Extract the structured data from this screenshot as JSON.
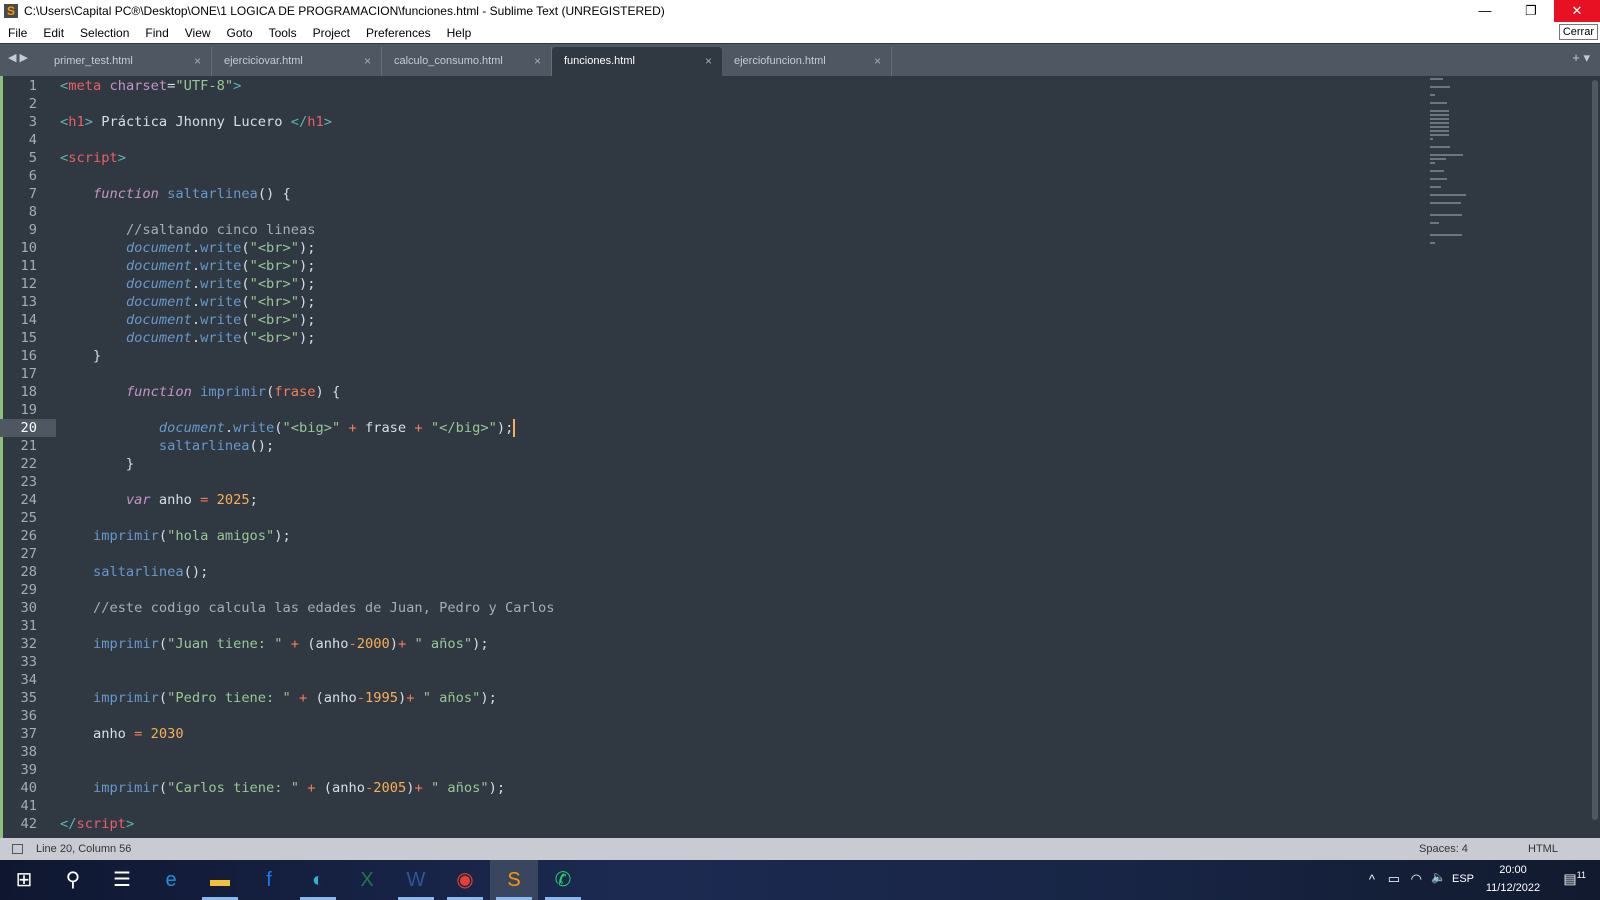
{
  "window": {
    "title": "C:\\Users\\Capital PC®\\Desktop\\ONE\\1 LOGICA DE PROGRAMACION\\funciones.html - Sublime Text (UNREGISTERED)",
    "minimize": "—",
    "restore": "❐",
    "close": "✕",
    "close_tooltip": "Cerrar"
  },
  "menu": [
    "File",
    "Edit",
    "Selection",
    "Find",
    "View",
    "Goto",
    "Tools",
    "Project",
    "Preferences",
    "Help"
  ],
  "tabs": [
    {
      "label": "primer_test.html"
    },
    {
      "label": "ejerciciovar.html"
    },
    {
      "label": "calculo_consumo.html"
    },
    {
      "label": "funciones.html",
      "active": true
    },
    {
      "label": "ejerciofuncion.html"
    }
  ],
  "tab_close": "×",
  "nav_arrows": "◀ ▶",
  "tab_tools": "+ ▾",
  "editor": {
    "current_line": 20,
    "lines": [
      [
        [
          "g",
          "<"
        ],
        [
          "t",
          "meta"
        ],
        [
          "a",
          " charset"
        ],
        [
          "p",
          "="
        ],
        [
          "s",
          "\"UTF-8\""
        ],
        [
          "g",
          ">"
        ]
      ],
      [],
      [
        [
          "g",
          "<"
        ],
        [
          "t",
          "h1"
        ],
        [
          "g",
          ">"
        ],
        [
          "p",
          " Práctica Jhonny Lucero "
        ],
        [
          "g",
          "</"
        ],
        [
          "t",
          "h1"
        ],
        [
          "g",
          ">"
        ]
      ],
      [],
      [
        [
          "g",
          "<"
        ],
        [
          "t",
          "script"
        ],
        [
          "g",
          ">"
        ]
      ],
      [],
      [
        [
          "p",
          "    "
        ],
        [
          "k",
          "function"
        ],
        [
          "p",
          " "
        ],
        [
          "f",
          "saltarlinea"
        ],
        [
          "p",
          "() {"
        ]
      ],
      [],
      [
        [
          "p",
          "        "
        ],
        [
          "c",
          "//saltando cinco lineas"
        ]
      ],
      [
        [
          "p",
          "        "
        ],
        [
          "d",
          "document"
        ],
        [
          "p",
          "."
        ],
        [
          "f",
          "write"
        ],
        [
          "p",
          "("
        ],
        [
          "s",
          "\"<br>\""
        ],
        [
          "p",
          ");"
        ]
      ],
      [
        [
          "p",
          "        "
        ],
        [
          "d",
          "document"
        ],
        [
          "p",
          "."
        ],
        [
          "f",
          "write"
        ],
        [
          "p",
          "("
        ],
        [
          "s",
          "\"<br>\""
        ],
        [
          "p",
          ");"
        ]
      ],
      [
        [
          "p",
          "        "
        ],
        [
          "d",
          "document"
        ],
        [
          "p",
          "."
        ],
        [
          "f",
          "write"
        ],
        [
          "p",
          "("
        ],
        [
          "s",
          "\"<br>\""
        ],
        [
          "p",
          ");"
        ]
      ],
      [
        [
          "p",
          "        "
        ],
        [
          "d",
          "document"
        ],
        [
          "p",
          "."
        ],
        [
          "f",
          "write"
        ],
        [
          "p",
          "("
        ],
        [
          "s",
          "\"<hr>\""
        ],
        [
          "p",
          ");"
        ]
      ],
      [
        [
          "p",
          "        "
        ],
        [
          "d",
          "document"
        ],
        [
          "p",
          "."
        ],
        [
          "f",
          "write"
        ],
        [
          "p",
          "("
        ],
        [
          "s",
          "\"<br>\""
        ],
        [
          "p",
          ");"
        ]
      ],
      [
        [
          "p",
          "        "
        ],
        [
          "d",
          "document"
        ],
        [
          "p",
          "."
        ],
        [
          "f",
          "write"
        ],
        [
          "p",
          "("
        ],
        [
          "s",
          "\"<br>\""
        ],
        [
          "p",
          ");"
        ]
      ],
      [
        [
          "p",
          "    }"
        ]
      ],
      [],
      [
        [
          "p",
          "        "
        ],
        [
          "k",
          "function"
        ],
        [
          "p",
          " "
        ],
        [
          "f",
          "imprimir"
        ],
        [
          "p",
          "("
        ],
        [
          "o",
          "frase"
        ],
        [
          "p",
          ") {"
        ]
      ],
      [],
      [
        [
          "p",
          "            "
        ],
        [
          "d",
          "document"
        ],
        [
          "p",
          "."
        ],
        [
          "f",
          "write"
        ],
        [
          "p",
          "("
        ],
        [
          "s",
          "\"<big>\""
        ],
        [
          "p",
          " "
        ],
        [
          "o",
          "+"
        ],
        [
          "p",
          " frase "
        ],
        [
          "o",
          "+"
        ],
        [
          "p",
          " "
        ],
        [
          "s",
          "\"</big>\""
        ],
        [
          "p",
          ");"
        ]
      ],
      [
        [
          "p",
          "            "
        ],
        [
          "f",
          "saltarlinea"
        ],
        [
          "p",
          "();"
        ]
      ],
      [
        [
          "p",
          "        }"
        ]
      ],
      [],
      [
        [
          "p",
          "        "
        ],
        [
          "k",
          "var"
        ],
        [
          "p",
          " anho "
        ],
        [
          "o",
          "="
        ],
        [
          "p",
          " "
        ],
        [
          "n",
          "2025"
        ],
        [
          "p",
          ";"
        ]
      ],
      [],
      [
        [
          "p",
          "    "
        ],
        [
          "f",
          "imprimir"
        ],
        [
          "p",
          "("
        ],
        [
          "s",
          "\"hola amigos\""
        ],
        [
          "p",
          ");"
        ]
      ],
      [],
      [
        [
          "p",
          "    "
        ],
        [
          "f",
          "saltarlinea"
        ],
        [
          "p",
          "();"
        ]
      ],
      [],
      [
        [
          "p",
          "    "
        ],
        [
          "c",
          "//este codigo calcula las edades de Juan, Pedro y Carlos"
        ]
      ],
      [],
      [
        [
          "p",
          "    "
        ],
        [
          "f",
          "imprimir"
        ],
        [
          "p",
          "("
        ],
        [
          "s",
          "\"Juan tiene: \""
        ],
        [
          "p",
          " "
        ],
        [
          "o",
          "+"
        ],
        [
          "p",
          " (anho"
        ],
        [
          "o",
          "-"
        ],
        [
          "n",
          "2000"
        ],
        [
          "p",
          ")"
        ],
        [
          "o",
          "+"
        ],
        [
          "p",
          " "
        ],
        [
          "s",
          "\" años\""
        ],
        [
          "p",
          ");"
        ]
      ],
      [],
      [],
      [
        [
          "p",
          "    "
        ],
        [
          "f",
          "imprimir"
        ],
        [
          "p",
          "("
        ],
        [
          "s",
          "\"Pedro tiene: \""
        ],
        [
          "p",
          " "
        ],
        [
          "o",
          "+"
        ],
        [
          "p",
          " (anho"
        ],
        [
          "o",
          "-"
        ],
        [
          "n",
          "1995"
        ],
        [
          "p",
          ")"
        ],
        [
          "o",
          "+"
        ],
        [
          "p",
          " "
        ],
        [
          "s",
          "\" años\""
        ],
        [
          "p",
          ");"
        ]
      ],
      [],
      [
        [
          "p",
          "    anho "
        ],
        [
          "o",
          "="
        ],
        [
          "p",
          " "
        ],
        [
          "n",
          "2030"
        ]
      ],
      [],
      [],
      [
        [
          "p",
          "    "
        ],
        [
          "f",
          "imprimir"
        ],
        [
          "p",
          "("
        ],
        [
          "s",
          "\"Carlos tiene: \""
        ],
        [
          "p",
          " "
        ],
        [
          "o",
          "+"
        ],
        [
          "p",
          " (anho"
        ],
        [
          "o",
          "-"
        ],
        [
          "n",
          "2005"
        ],
        [
          "p",
          ")"
        ],
        [
          "o",
          "+"
        ],
        [
          "p",
          " "
        ],
        [
          "s",
          "\" años\""
        ],
        [
          "p",
          ");"
        ]
      ],
      [],
      [
        [
          "g",
          "</"
        ],
        [
          "t",
          "script"
        ],
        [
          "g",
          ">"
        ]
      ]
    ]
  },
  "status": {
    "position": "Line 20, Column 56",
    "indent": "Spaces: 4",
    "syntax": "HTML"
  },
  "taskbar": {
    "apps": [
      {
        "name": "start",
        "glyph": "⊞",
        "color": "#ffffff"
      },
      {
        "name": "search",
        "glyph": "⚲",
        "color": "#ffffff"
      },
      {
        "name": "task-view",
        "glyph": "☰",
        "color": "#ffffff"
      },
      {
        "name": "internet-explorer",
        "glyph": "e",
        "color": "#1e8fe0"
      },
      {
        "name": "file-explorer",
        "glyph": "▬",
        "color": "#f3c13a",
        "open": true
      },
      {
        "name": "facebook",
        "glyph": "f",
        "color": "#1877f2"
      },
      {
        "name": "edge",
        "glyph": "◐",
        "color": "#2fb5c8",
        "open": true
      },
      {
        "name": "excel",
        "glyph": "X",
        "color": "#1d7a45"
      },
      {
        "name": "word",
        "glyph": "W",
        "color": "#2b579a",
        "open": true
      },
      {
        "name": "chrome",
        "glyph": "◉",
        "color": "#e44134",
        "open": true
      },
      {
        "name": "sublime-text",
        "glyph": "S",
        "color": "#ff9800",
        "open": true,
        "active": true
      },
      {
        "name": "whatsapp",
        "glyph": "✆",
        "color": "#25d366",
        "open": true
      }
    ],
    "tray": {
      "chevron": "^",
      "battery": "▭",
      "wifi": "◠",
      "volume": "🔈",
      "language": "ESP",
      "time": "20:00",
      "date": "11/12/2022",
      "notifications": "11"
    }
  }
}
